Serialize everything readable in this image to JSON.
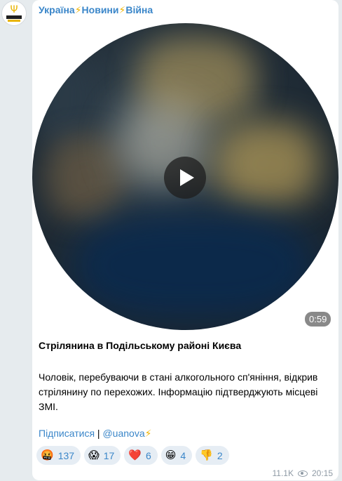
{
  "channel": {
    "name_part1": "Україна",
    "name_part2": "Новини",
    "name_part3": "Війна",
    "separator": "⚡"
  },
  "post": {
    "video_duration": "0:59",
    "title": "Стрілянина в Подільському районі Києва",
    "body": "Чоловік, перебуваючи в стані алкогольного сп'яніння, відкрив стрілянину по перехожих. Інформацію підтверджують місцеві ЗМІ.",
    "subscribe_label": "Підписатися",
    "link_separator": " | ",
    "handle": "@uanova",
    "handle_bolt": "⚡"
  },
  "reactions": [
    {
      "emoji": "🤬",
      "count": "137",
      "icon_name": "angry-face-icon"
    },
    {
      "emoji": "😱",
      "count": "17",
      "icon_name": "scream-face-icon"
    },
    {
      "emoji": "❤️",
      "count": "6",
      "icon_name": "heart-icon"
    },
    {
      "emoji": "😁",
      "count": "4",
      "icon_name": "grin-face-icon"
    },
    {
      "emoji": "👎",
      "count": "2",
      "icon_name": "thumbs-down-icon"
    }
  ],
  "meta": {
    "views": "11.1K",
    "time": "20:15"
  },
  "colors": {
    "accent": "#3a86c9",
    "background": "#e6ebee",
    "bolt": "#f0b400"
  }
}
